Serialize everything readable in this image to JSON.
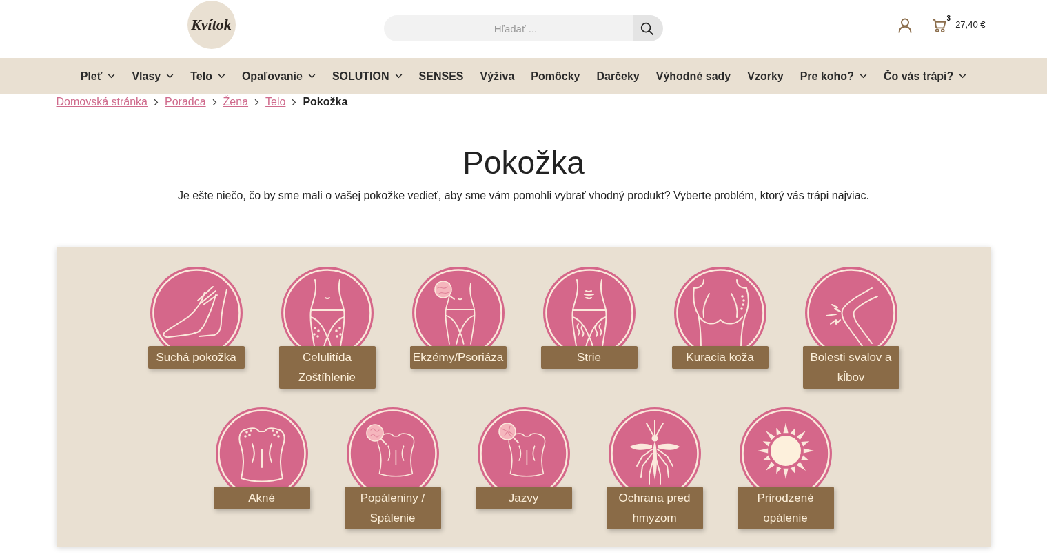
{
  "header": {
    "logo": "Kvítok",
    "search": {
      "placeholder": "Hľadať ..."
    },
    "cart": {
      "count": "3",
      "total": "27,40 €"
    }
  },
  "nav": [
    {
      "label": "Pleť",
      "has_submenu": true
    },
    {
      "label": "Vlasy",
      "has_submenu": true
    },
    {
      "label": "Telo",
      "has_submenu": true
    },
    {
      "label": "Opaľovanie",
      "has_submenu": true
    },
    {
      "label": "SOLUTION",
      "has_submenu": true
    },
    {
      "label": "SENSES",
      "has_submenu": false
    },
    {
      "label": "Výživa",
      "has_submenu": false
    },
    {
      "label": "Pomôcky",
      "has_submenu": false
    },
    {
      "label": "Darčeky",
      "has_submenu": false
    },
    {
      "label": "Výhodné sady",
      "has_submenu": false
    },
    {
      "label": "Vzorky",
      "has_submenu": false
    },
    {
      "label": "Pre koho?",
      "has_submenu": true
    },
    {
      "label": "Čo vás trápi?",
      "has_submenu": true
    }
  ],
  "breadcrumb": [
    {
      "label": "Domovská stránka",
      "current": false
    },
    {
      "label": "Poradca",
      "current": false
    },
    {
      "label": "Žena",
      "current": false
    },
    {
      "label": "Telo",
      "current": false
    },
    {
      "label": "Pokožka",
      "current": true
    }
  ],
  "page": {
    "title": "Pokožka",
    "intro": "Je ešte niečo, čo by sme mali o vašej pokožke vedieť, aby sme vám pomohli vybrať vhodný produkt? Vyberte problém, ktorý vás trápi najviac."
  },
  "problems": [
    {
      "label": "Suchá pokožka"
    },
    {
      "label": "Celulitída Zoštíhlenie"
    },
    {
      "label": "Ekzémy/Psoriáza"
    },
    {
      "label": "Strie"
    },
    {
      "label": "Kuracia koža"
    },
    {
      "label": "Bolesti svalov a kĺbov"
    },
    {
      "label": "Akné"
    },
    {
      "label": "Popáleniny / Spálenie"
    },
    {
      "label": "Jazvy"
    },
    {
      "label": "Ochrana pred hmyzom"
    },
    {
      "label": "Prirodzené opálenie"
    }
  ]
}
